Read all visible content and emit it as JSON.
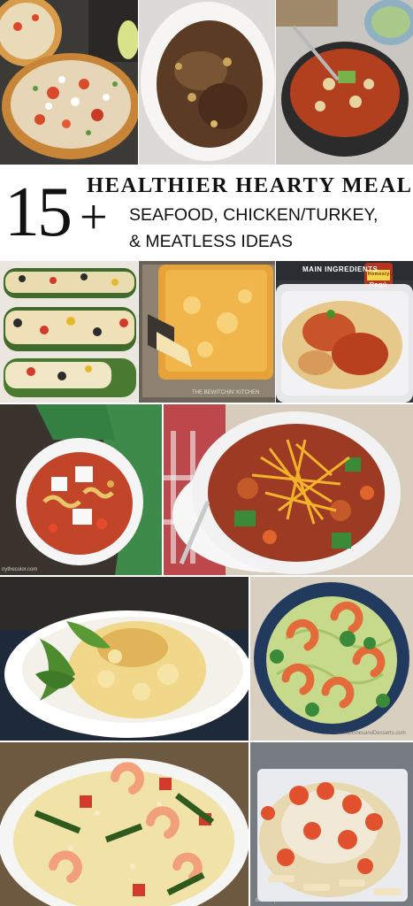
{
  "title": {
    "number": "15",
    "plus": "+",
    "main": "HEALTHIER HEARTY MEALS",
    "sub_line1": "SEAFOOD, CHICKEN/TURKEY,",
    "sub_line2": "& MEATLESS IDEAS"
  },
  "tile_labels": {
    "main_ingredients": "MAIN INGREDIENTS",
    "bewitchin_kitchen": "THE BEWITCHIN' KITCHEN",
    "ragu_brand": "Ragú",
    "ragu_sub": "Homestyle",
    "soup_credit": "nythecolor.com",
    "shrimp_credit": "DinnersDishesandDesserts.com",
    "pasta_credit": "bestrecipes"
  }
}
